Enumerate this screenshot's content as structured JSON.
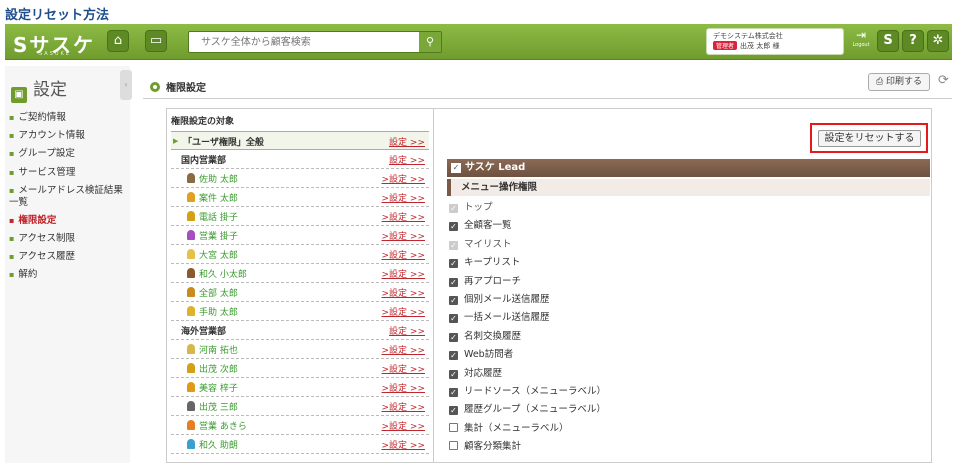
{
  "caption": "設定リセット方法",
  "header": {
    "logo": "Sサスケ",
    "logo_sub": "SASUKE",
    "search_placeholder": "サスケ全体から顧客検索",
    "company_name": "デモシステム株式会社",
    "user_badge": "管理者",
    "user_name": "出茂 太郎 様",
    "logout_label": "Logout",
    "help_label": "?",
    "s_label": "S"
  },
  "sidebar": {
    "title": "設定",
    "items": [
      {
        "label": "ご契約情報"
      },
      {
        "label": "アカウント情報"
      },
      {
        "label": "グループ設定"
      },
      {
        "label": "サービス管理"
      },
      {
        "label": "メールアドレス検証結果一覧"
      },
      {
        "label": "権限設定"
      },
      {
        "label": "アクセス制限"
      },
      {
        "label": "アクセス履歴"
      },
      {
        "label": "解約"
      }
    ]
  },
  "main": {
    "title": "権限設定",
    "print_label": "印刷する",
    "target_heading": "権限設定の対象",
    "root_row": {
      "label": "「ユーザ権限」全般",
      "link": "設定 >>"
    },
    "rows": [
      {
        "type": "grp",
        "label": "国内営業部",
        "link": "設定 >>"
      },
      {
        "type": "user",
        "label": "佐助 太郎",
        "link": ">設定 >>",
        "color": "#8b6b43"
      },
      {
        "type": "user",
        "label": "案件 太郎",
        "link": ">設定 >>",
        "color": "#e0a020"
      },
      {
        "type": "user",
        "label": "電話 掛子",
        "link": ">設定 >>",
        "color": "#d4a017"
      },
      {
        "type": "user",
        "label": "営業 掛子",
        "link": ">設定 >>",
        "color": "#a64dc2"
      },
      {
        "type": "user",
        "label": "大宮 太郎",
        "link": ">設定 >>",
        "color": "#e6c14a"
      },
      {
        "type": "user",
        "label": "和久 小太郎",
        "link": ">設定 >>",
        "color": "#8b5a2b"
      },
      {
        "type": "user",
        "label": "全部 太郎",
        "link": ">設定 >>",
        "color": "#c88b1e"
      },
      {
        "type": "user",
        "label": "手助 太郎",
        "link": ">設定 >>",
        "color": "#e1b12c"
      },
      {
        "type": "grp",
        "label": "海外営業部",
        "link": "設定 >>"
      },
      {
        "type": "user",
        "label": "河南 拓也",
        "link": ">設定 >>",
        "color": "#d9b64a"
      },
      {
        "type": "user",
        "label": "出茂 次郎",
        "link": ">設定 >>",
        "color": "#d4a017"
      },
      {
        "type": "user",
        "label": "美容 梓子",
        "link": ">設定 >>",
        "color": "#e09a16"
      },
      {
        "type": "user",
        "label": "出茂 三郎",
        "link": ">設定 >>",
        "color": "#666666"
      },
      {
        "type": "user",
        "label": "営業 あきら",
        "link": ">設定 >>",
        "color": "#e67e22"
      },
      {
        "type": "user",
        "label": "和久 助朗",
        "link": ">設定 >>",
        "color": "#3aa0d0"
      }
    ],
    "reset_label": "設定をリセットする",
    "app_label": "サスケ Lead",
    "menu_perm_label": "メニュー操作権限",
    "permissions": [
      {
        "label": "トップ",
        "state": "disabled"
      },
      {
        "label": "全顧客一覧",
        "state": "checked"
      },
      {
        "label": "マイリスト",
        "state": "disabled"
      },
      {
        "label": "キープリスト",
        "state": "checked"
      },
      {
        "label": "再アプローチ",
        "state": "checked"
      },
      {
        "label": "個別メール送信履歴",
        "state": "checked"
      },
      {
        "label": "一括メール送信履歴",
        "state": "checked"
      },
      {
        "label": "名刺交換履歴",
        "state": "checked"
      },
      {
        "label": "Web訪問者",
        "state": "checked"
      },
      {
        "label": "対応履歴",
        "state": "checked"
      },
      {
        "label": "リードソース（メニューラベル）",
        "state": "checked"
      },
      {
        "label": "履歴グループ（メニューラベル）",
        "state": "checked"
      },
      {
        "label": "集計（メニューラベル）",
        "state": "unchecked"
      },
      {
        "label": "顧客分類集計",
        "state": "unchecked"
      }
    ]
  }
}
